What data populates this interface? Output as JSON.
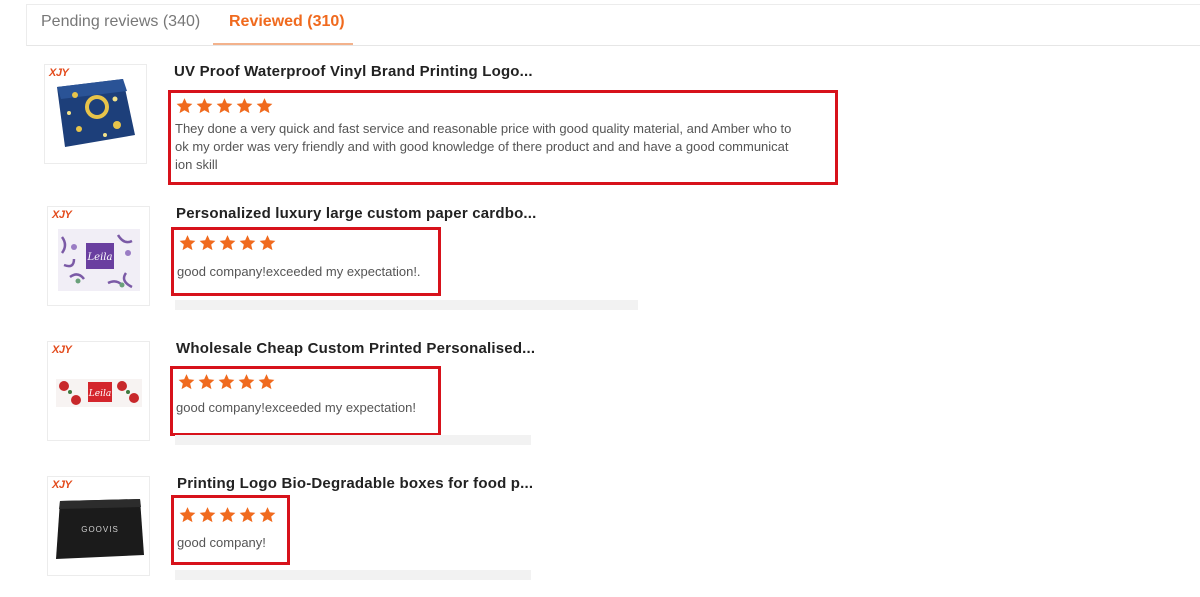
{
  "tabs": {
    "pending": "Pending reviews (340)",
    "reviewed": "Reviewed (310)"
  },
  "colors": {
    "accent": "#f06a1e",
    "star": "#f06a1e",
    "highlight_box": "#d7121b"
  },
  "reviews": [
    {
      "brand": "XJY",
      "title": "UV Proof Waterproof Vinyl Brand Printing Logo...",
      "rating": 5,
      "text_lines": [
        "They done a very quick and fast service and reasonable price with good quality material, and Amber who to",
        "ok my order was very friendly and with good knowledge of there product and and have a good communicat",
        "ion skill"
      ],
      "image_label": ""
    },
    {
      "brand": "XJY",
      "title": "Personalized luxury large custom paper cardbo...",
      "rating": 5,
      "text_lines": [
        "good company!exceeded my expectation!."
      ],
      "image_label": "Leila"
    },
    {
      "brand": "XJY",
      "title": "Wholesale Cheap Custom Printed Personalised...",
      "rating": 5,
      "text_lines": [
        "good company!exceeded my expectation!"
      ],
      "image_label": "Leila"
    },
    {
      "brand": "XJY",
      "title": "Printing Logo Bio-Degradable boxes for food p...",
      "rating": 5,
      "text_lines": [
        "good company!"
      ],
      "image_label": "GOOVIS"
    }
  ]
}
